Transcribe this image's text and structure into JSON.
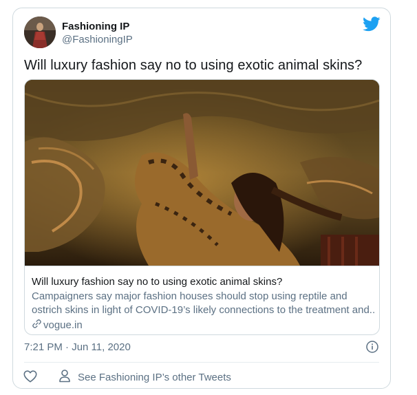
{
  "author": {
    "name": "Fashioning IP",
    "handle": "@FashioningIP"
  },
  "tweet": {
    "text": "Will luxury fashion say no to using exotic animal skins?",
    "timestamp": "7:21 PM · Jun 11, 2020"
  },
  "card": {
    "title": "Will luxury fashion say no to using exotic animal skins?",
    "description_line1": "Campaigners say major fashion houses should stop using reptile and",
    "description_line2": "ostrich skins in light of COVID-19’s likely connections to the treatment and..",
    "domain": "vogue.in"
  },
  "actions": {
    "other_tweets_label": "See Fashioning IP’s other Tweets"
  },
  "colors": {
    "twitter_blue": "#1da1f2",
    "secondary_text": "#5b7083",
    "border": "#cfd9de"
  },
  "icons": {
    "logo": "twitter-bird-icon",
    "link": "link-icon",
    "info": "info-icon",
    "like": "heart-icon",
    "person": "person-icon"
  }
}
